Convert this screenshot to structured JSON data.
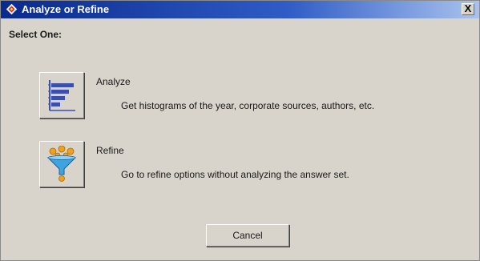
{
  "window": {
    "title": "Analyze or Refine",
    "close_label": "X"
  },
  "prompt": "Select One:",
  "options": [
    {
      "label": "Analyze",
      "description": "Get histograms of the year, corporate sources, authors, etc.",
      "icon": "histogram-icon"
    },
    {
      "label": "Refine",
      "description": "Go to refine options without analyzing the answer set.",
      "icon": "funnel-icon"
    }
  ],
  "cancel_label": "Cancel",
  "colors": {
    "titlebar_start": "#0a2a8c",
    "titlebar_end": "#a9c3ee",
    "dialog_background": "#d8d4cc",
    "histogram_bar": "#3a4fb0",
    "funnel_body": "#3ea4e0",
    "funnel_balls": "#f0a020"
  }
}
